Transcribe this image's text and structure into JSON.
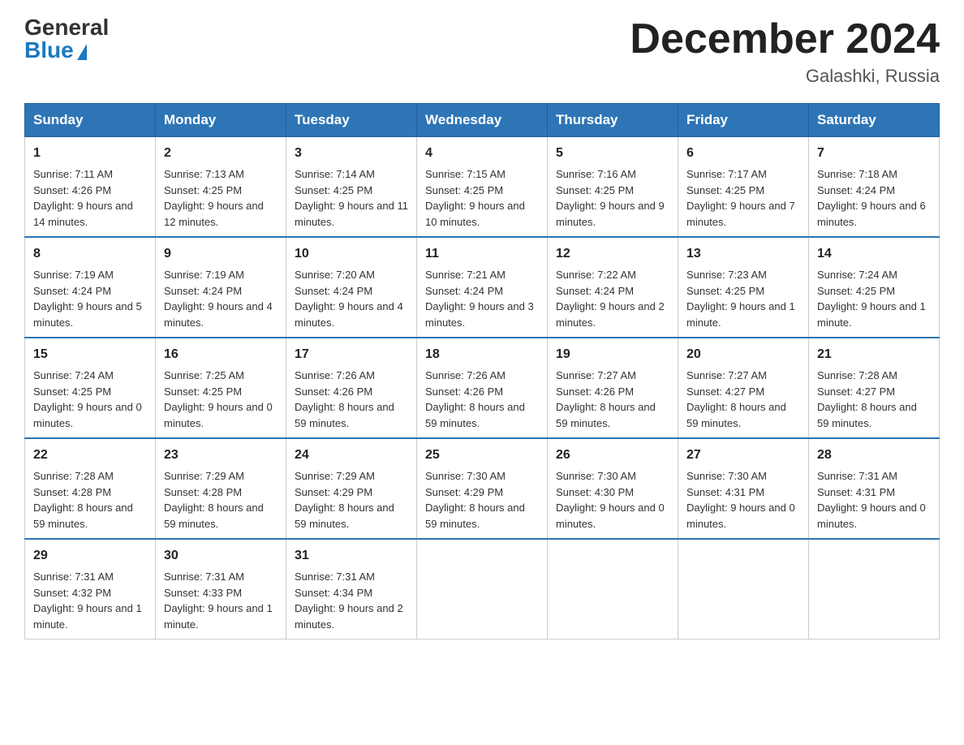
{
  "header": {
    "logo_general": "General",
    "logo_blue": "Blue",
    "month_year": "December 2024",
    "location": "Galashki, Russia"
  },
  "days_of_week": [
    "Sunday",
    "Monday",
    "Tuesday",
    "Wednesday",
    "Thursday",
    "Friday",
    "Saturday"
  ],
  "weeks": [
    [
      {
        "day": "1",
        "sunrise": "7:11 AM",
        "sunset": "4:26 PM",
        "daylight": "9 hours and 14 minutes."
      },
      {
        "day": "2",
        "sunrise": "7:13 AM",
        "sunset": "4:25 PM",
        "daylight": "9 hours and 12 minutes."
      },
      {
        "day": "3",
        "sunrise": "7:14 AM",
        "sunset": "4:25 PM",
        "daylight": "9 hours and 11 minutes."
      },
      {
        "day": "4",
        "sunrise": "7:15 AM",
        "sunset": "4:25 PM",
        "daylight": "9 hours and 10 minutes."
      },
      {
        "day": "5",
        "sunrise": "7:16 AM",
        "sunset": "4:25 PM",
        "daylight": "9 hours and 9 minutes."
      },
      {
        "day": "6",
        "sunrise": "7:17 AM",
        "sunset": "4:25 PM",
        "daylight": "9 hours and 7 minutes."
      },
      {
        "day": "7",
        "sunrise": "7:18 AM",
        "sunset": "4:24 PM",
        "daylight": "9 hours and 6 minutes."
      }
    ],
    [
      {
        "day": "8",
        "sunrise": "7:19 AM",
        "sunset": "4:24 PM",
        "daylight": "9 hours and 5 minutes."
      },
      {
        "day": "9",
        "sunrise": "7:19 AM",
        "sunset": "4:24 PM",
        "daylight": "9 hours and 4 minutes."
      },
      {
        "day": "10",
        "sunrise": "7:20 AM",
        "sunset": "4:24 PM",
        "daylight": "9 hours and 4 minutes."
      },
      {
        "day": "11",
        "sunrise": "7:21 AM",
        "sunset": "4:24 PM",
        "daylight": "9 hours and 3 minutes."
      },
      {
        "day": "12",
        "sunrise": "7:22 AM",
        "sunset": "4:24 PM",
        "daylight": "9 hours and 2 minutes."
      },
      {
        "day": "13",
        "sunrise": "7:23 AM",
        "sunset": "4:25 PM",
        "daylight": "9 hours and 1 minute."
      },
      {
        "day": "14",
        "sunrise": "7:24 AM",
        "sunset": "4:25 PM",
        "daylight": "9 hours and 1 minute."
      }
    ],
    [
      {
        "day": "15",
        "sunrise": "7:24 AM",
        "sunset": "4:25 PM",
        "daylight": "9 hours and 0 minutes."
      },
      {
        "day": "16",
        "sunrise": "7:25 AM",
        "sunset": "4:25 PM",
        "daylight": "9 hours and 0 minutes."
      },
      {
        "day": "17",
        "sunrise": "7:26 AM",
        "sunset": "4:26 PM",
        "daylight": "8 hours and 59 minutes."
      },
      {
        "day": "18",
        "sunrise": "7:26 AM",
        "sunset": "4:26 PM",
        "daylight": "8 hours and 59 minutes."
      },
      {
        "day": "19",
        "sunrise": "7:27 AM",
        "sunset": "4:26 PM",
        "daylight": "8 hours and 59 minutes."
      },
      {
        "day": "20",
        "sunrise": "7:27 AM",
        "sunset": "4:27 PM",
        "daylight": "8 hours and 59 minutes."
      },
      {
        "day": "21",
        "sunrise": "7:28 AM",
        "sunset": "4:27 PM",
        "daylight": "8 hours and 59 minutes."
      }
    ],
    [
      {
        "day": "22",
        "sunrise": "7:28 AM",
        "sunset": "4:28 PM",
        "daylight": "8 hours and 59 minutes."
      },
      {
        "day": "23",
        "sunrise": "7:29 AM",
        "sunset": "4:28 PM",
        "daylight": "8 hours and 59 minutes."
      },
      {
        "day": "24",
        "sunrise": "7:29 AM",
        "sunset": "4:29 PM",
        "daylight": "8 hours and 59 minutes."
      },
      {
        "day": "25",
        "sunrise": "7:30 AM",
        "sunset": "4:29 PM",
        "daylight": "8 hours and 59 minutes."
      },
      {
        "day": "26",
        "sunrise": "7:30 AM",
        "sunset": "4:30 PM",
        "daylight": "9 hours and 0 minutes."
      },
      {
        "day": "27",
        "sunrise": "7:30 AM",
        "sunset": "4:31 PM",
        "daylight": "9 hours and 0 minutes."
      },
      {
        "day": "28",
        "sunrise": "7:31 AM",
        "sunset": "4:31 PM",
        "daylight": "9 hours and 0 minutes."
      }
    ],
    [
      {
        "day": "29",
        "sunrise": "7:31 AM",
        "sunset": "4:32 PM",
        "daylight": "9 hours and 1 minute."
      },
      {
        "day": "30",
        "sunrise": "7:31 AM",
        "sunset": "4:33 PM",
        "daylight": "9 hours and 1 minute."
      },
      {
        "day": "31",
        "sunrise": "7:31 AM",
        "sunset": "4:34 PM",
        "daylight": "9 hours and 2 minutes."
      },
      null,
      null,
      null,
      null
    ]
  ]
}
